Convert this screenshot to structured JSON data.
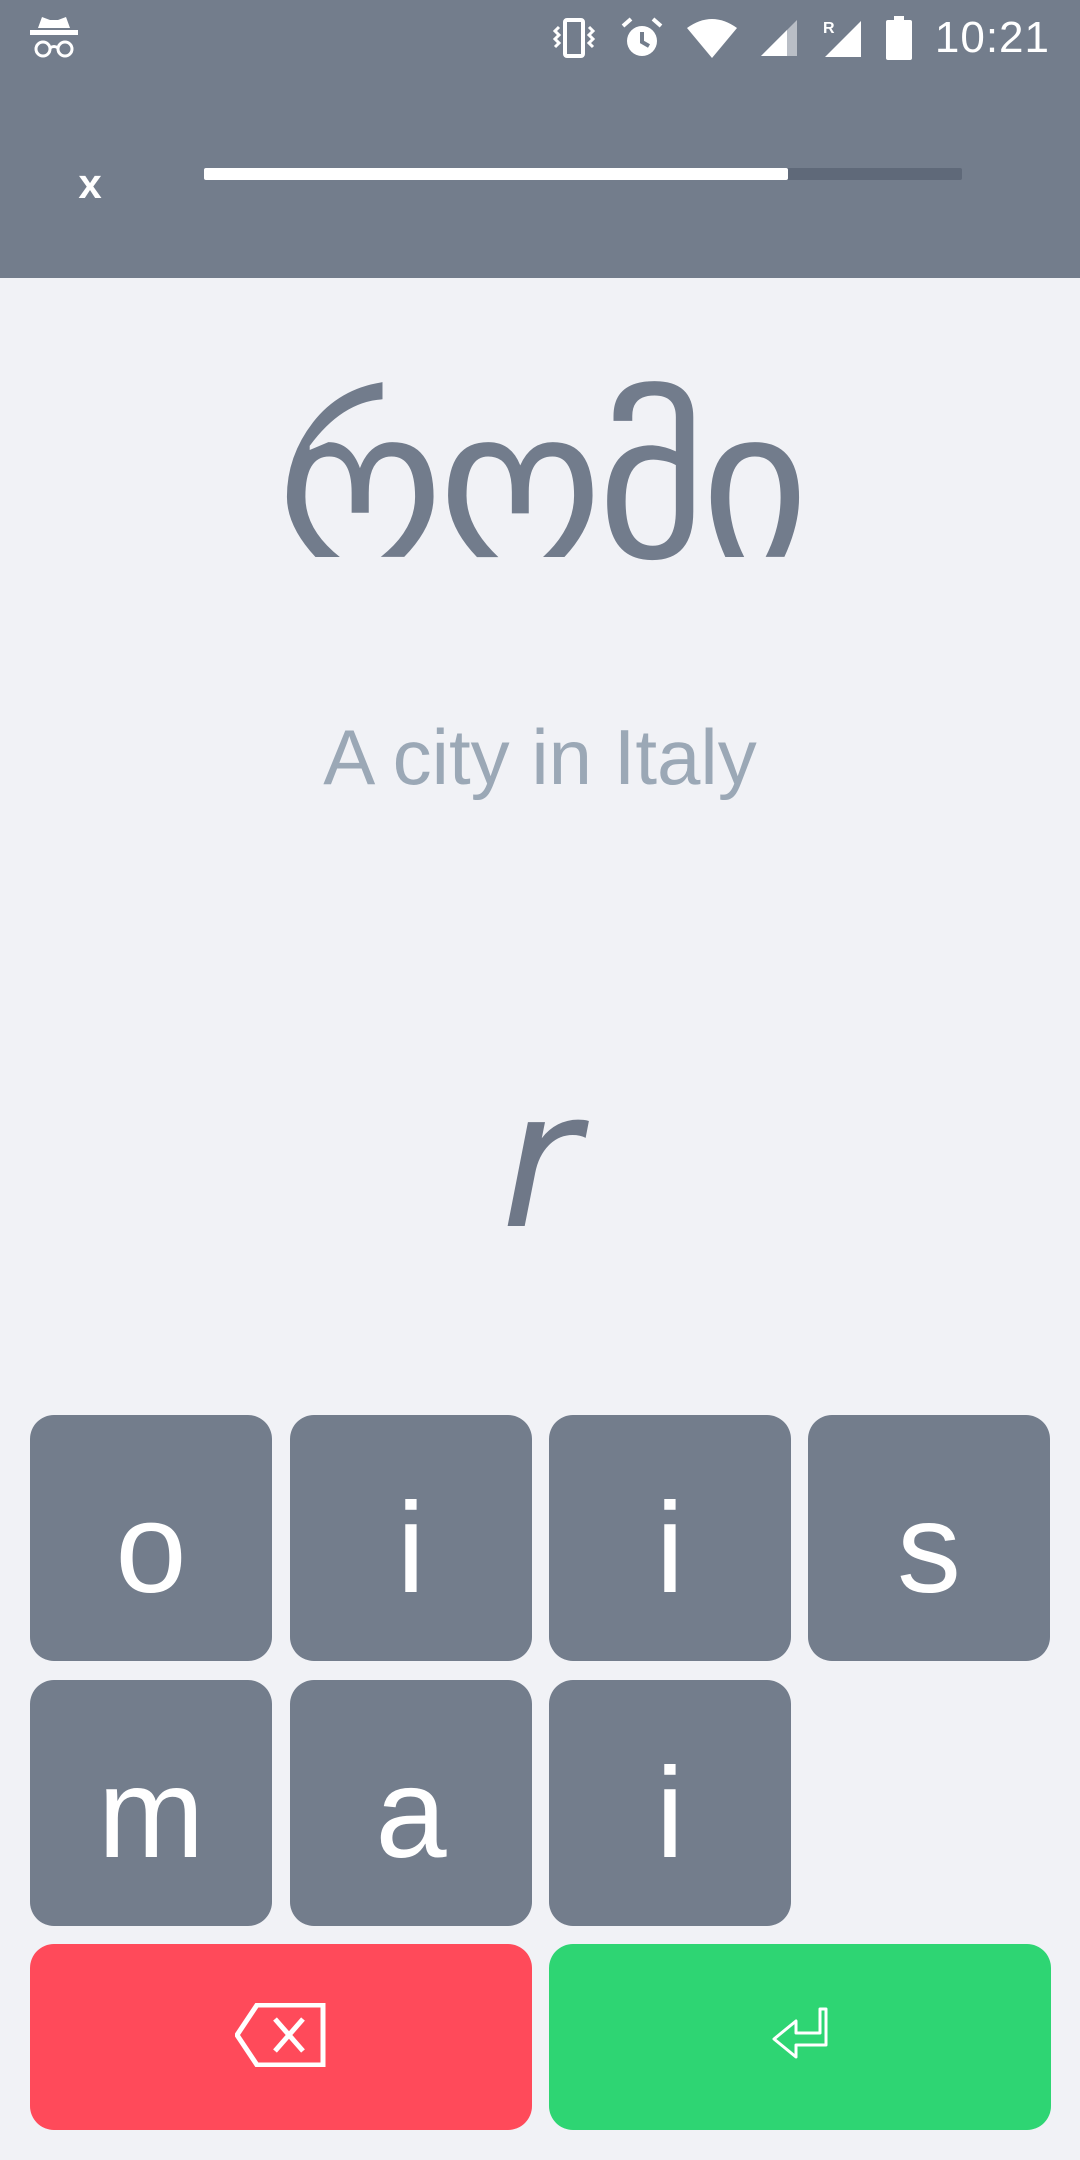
{
  "status_bar": {
    "time": "10:21",
    "left_icon": "incognito-icon",
    "right_icons": [
      "vibrate-icon",
      "alarm-icon",
      "wifi-icon",
      "signal-icon",
      "roaming-signal-icon",
      "battery-icon"
    ]
  },
  "header": {
    "close_label": "x",
    "progress": 0.77
  },
  "prompt": {
    "word": "რომი",
    "hint": "A city in Italy",
    "answer": "r"
  },
  "keys": [
    "o",
    "i",
    "i",
    "s",
    "m",
    "a",
    "i"
  ],
  "actions": {
    "delete_icon": "backspace-icon",
    "enter_icon": "enter-icon"
  },
  "colors": {
    "header_bg": "#737D8C",
    "key_bg": "#737D8C",
    "delete_bg": "#FF4A5A",
    "enter_bg": "#2ED573",
    "page_bg": "#F1F2F6"
  }
}
